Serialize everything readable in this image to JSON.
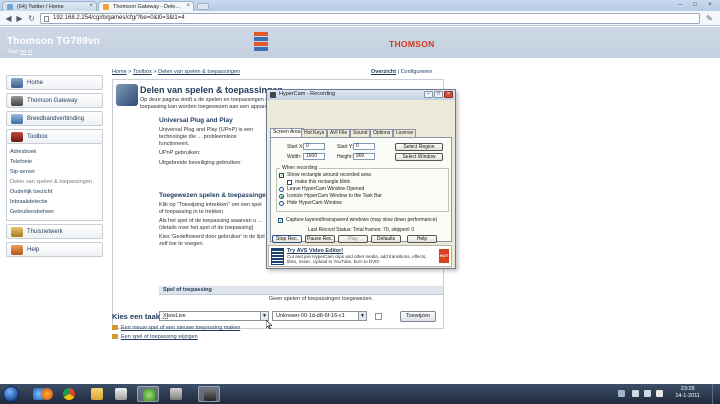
{
  "browser": {
    "tabs": [
      {
        "title": "(64) Twitter / Home"
      },
      {
        "title": "Thomson Gateway - Dele..."
      }
    ],
    "url": "192.168.2.254/cgi/b/games/cfg/?be=0&l0=3&l1=4"
  },
  "header": {
    "model": "Thomson TG789vn",
    "lang_label": "Taal:",
    "lang_links": [
      "en",
      "nl"
    ],
    "brand": "THOMSON"
  },
  "sidebar": {
    "items": [
      {
        "label": "Home"
      },
      {
        "label": "Thomson Gateway"
      },
      {
        "label": "Breedbandverbinding"
      },
      {
        "label": "Toolbox"
      },
      {
        "label": "Thuisnetwerk"
      },
      {
        "label": "Help"
      }
    ],
    "toolbox_sub": [
      "Adresboek",
      "Telefonie",
      "Sip-server",
      "Delen van spelen & toepassingen",
      "Ouderlijk toezicht",
      "Inbraakdetectie",
      "Gebruikersbeheer"
    ]
  },
  "breadcrumb": {
    "home": "Home",
    "sep": ">",
    "toolbox": "Toolbox",
    "current": "Delen van spelen & toepassingen"
  },
  "view_links": {
    "overview": "Overzicht",
    "sep": "|",
    "configure": "Configureren"
  },
  "panel": {
    "title": "Delen van spelen & toepassingen",
    "intro": "Op deze pagina vindt u de spelen en toepassingen die in uw Thomson Gateway staan gedefinieerd. Elk spel of elke toepassing kan worden toegewezen aan een apparaat op uw lokale netwerk.",
    "upnp_title": "Universal Plug and Play",
    "upnp_text": "Universal Plug and Play (UPnP) is een technologie die ... probleemloos functioneert.",
    "upnp_used": "UPnP gebruiken:",
    "upnp_ext": "Uitgebreide beveiliging gebruiken:",
    "assign_title": "Toegewezen spelen & toepassingen",
    "assign_text_1": "Klik op \"Toewijzing intrekken\" om een spel of toepassing in te trekken.",
    "assign_text_2": "Als het spel of de toepassing waarvan u ... (details over het spel of de toepassing)",
    "assign_text_3": "Kies 'Gedefinieerd door gebruiker' in de lijst zelf toe te voegen.",
    "col_game": "Spel of toepassing",
    "empty": "Geen spelen of toepassingen toegewezen.",
    "game_select": "XboxLive",
    "device_select": "Unknown-00-1d-d8-6f-16-c1",
    "assign_button": "Toewijzen"
  },
  "tasks": {
    "title": "Kies een taak ...",
    "items": [
      "Een nieuw spel of een nieuwe toepassing maken",
      "Een spel of toepassing wijzigen"
    ]
  },
  "hypercam": {
    "title": "HyperCam - Recording",
    "tabs": [
      "Screen Area",
      "Hot Keys",
      "AVI File",
      "Sound",
      "Options",
      "License"
    ],
    "start_x_label": "Start X:",
    "start_x": "0",
    "start_y_label": "Start Y:",
    "start_y": "0",
    "width_label": "Width:",
    "width": "1600",
    "height_label": "Height:",
    "height": "900",
    "select_region": "Select Region",
    "select_window": "Select Window",
    "when_recording": "When recording",
    "opt_show_rect": "Show rectangle around recorded area",
    "opt_blink": "make this rectangle blink",
    "opt_leave": "Leave HyperCam Window Opened",
    "opt_iconize": "Iconize HyperCam Window to the Task Bar",
    "opt_hide": "Hide HyperCam Window",
    "opt_layered": "Capture layered/transparent windows (may slow down performance)",
    "status": "Last Record Status: Total frames: 70, skipped: 0",
    "buttons": [
      "Stop Rec.",
      "Pause Rec.",
      "Play",
      "Defaults",
      "Help"
    ],
    "ad_title": "Try AVS Video Editor!",
    "ad_text": "Cut and join HyperCam clips and other media, add transitions, effects, titles, music. Upload to YouTube, burn to DVD!",
    "ad_badge": "HOT"
  },
  "taskbar": {
    "time": "23:28",
    "date": "14-1-2011"
  },
  "colors": {
    "header_bg": "#c3cfdf",
    "brand_red": "#d63a1a",
    "link_blue": "#1e3a5c",
    "taskbar": "#1f2a3a"
  }
}
